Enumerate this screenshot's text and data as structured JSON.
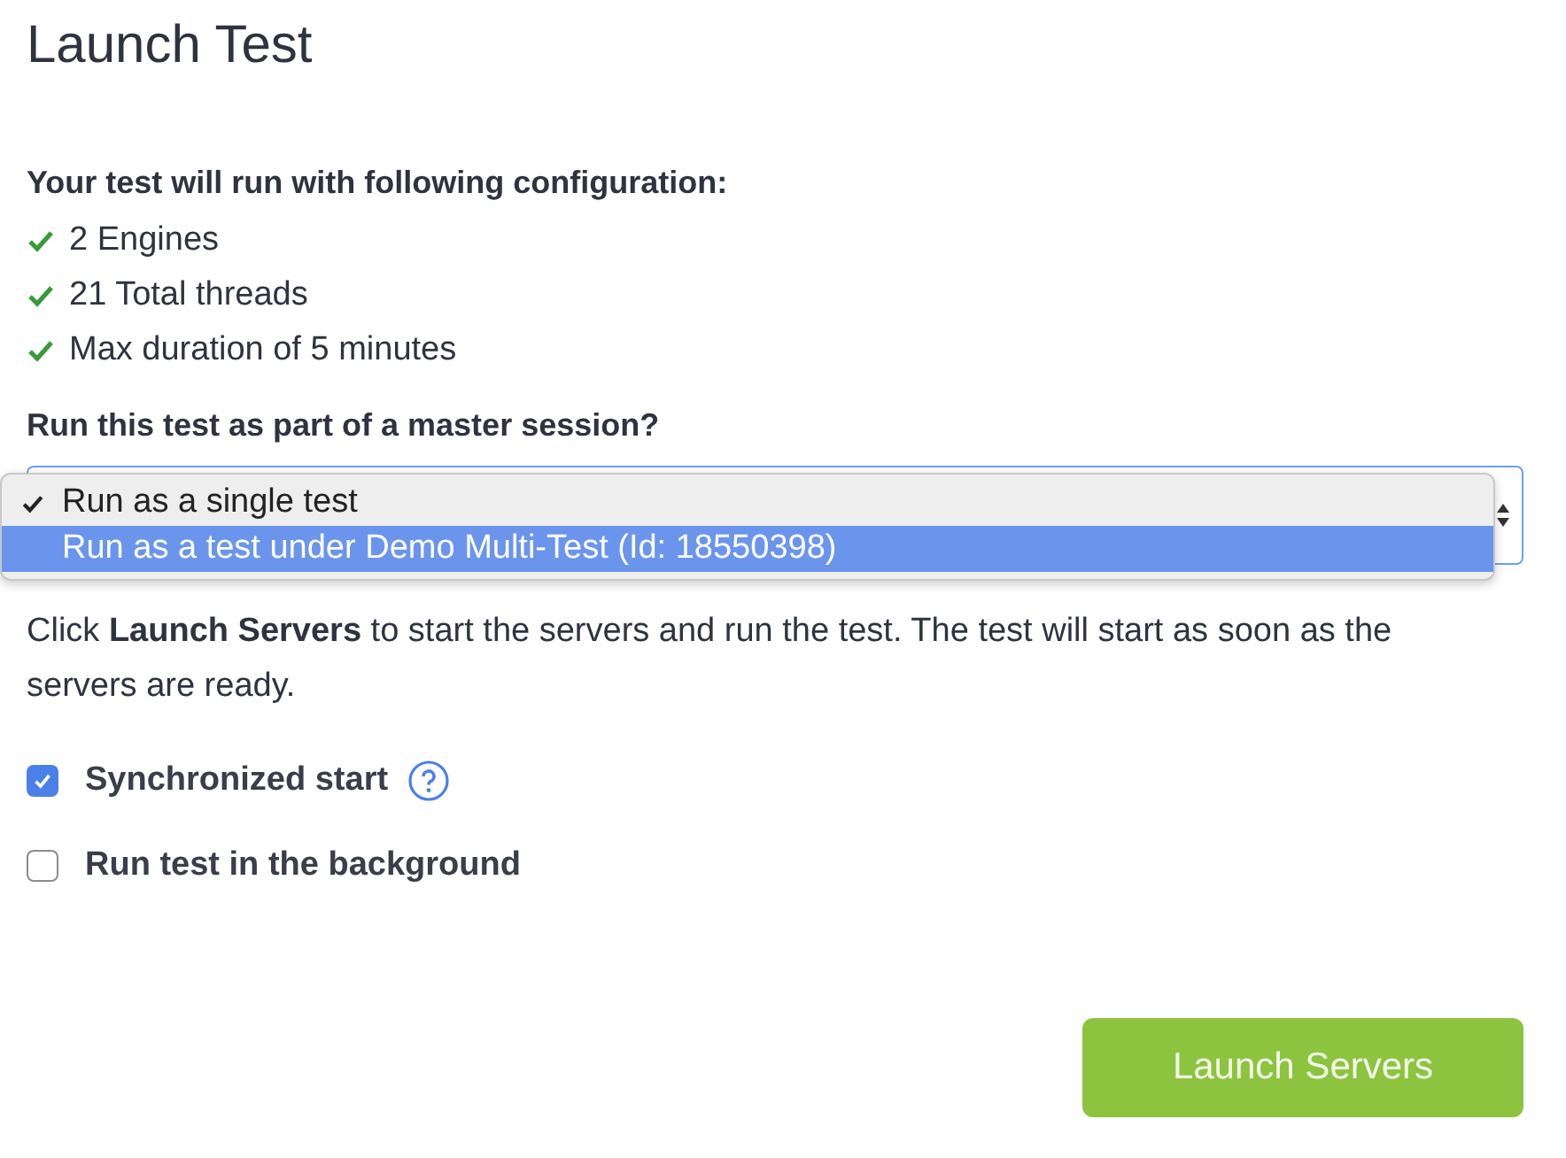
{
  "title": "Launch Test",
  "config_heading": "Your test will run with following configuration:",
  "config_items": [
    "2 Engines",
    "21 Total threads",
    "Max duration of 5 minutes"
  ],
  "session_question": "Run this test as part of a master session?",
  "session_menu": {
    "options": [
      {
        "label": "Run as a single test",
        "checked": true,
        "highlighted": false
      },
      {
        "label": "Run as a test under Demo Multi-Test (Id: 18550398)",
        "checked": false,
        "highlighted": true
      }
    ]
  },
  "info": "Click **Launch Servers** to start the servers and run the test. The test will start as soon as the servers are ready.",
  "options": [
    {
      "label": "Synchronized start",
      "checked": true,
      "help": true
    },
    {
      "label": "Run test in the background",
      "checked": false,
      "help": false
    }
  ],
  "launch_button": "Launch Servers"
}
